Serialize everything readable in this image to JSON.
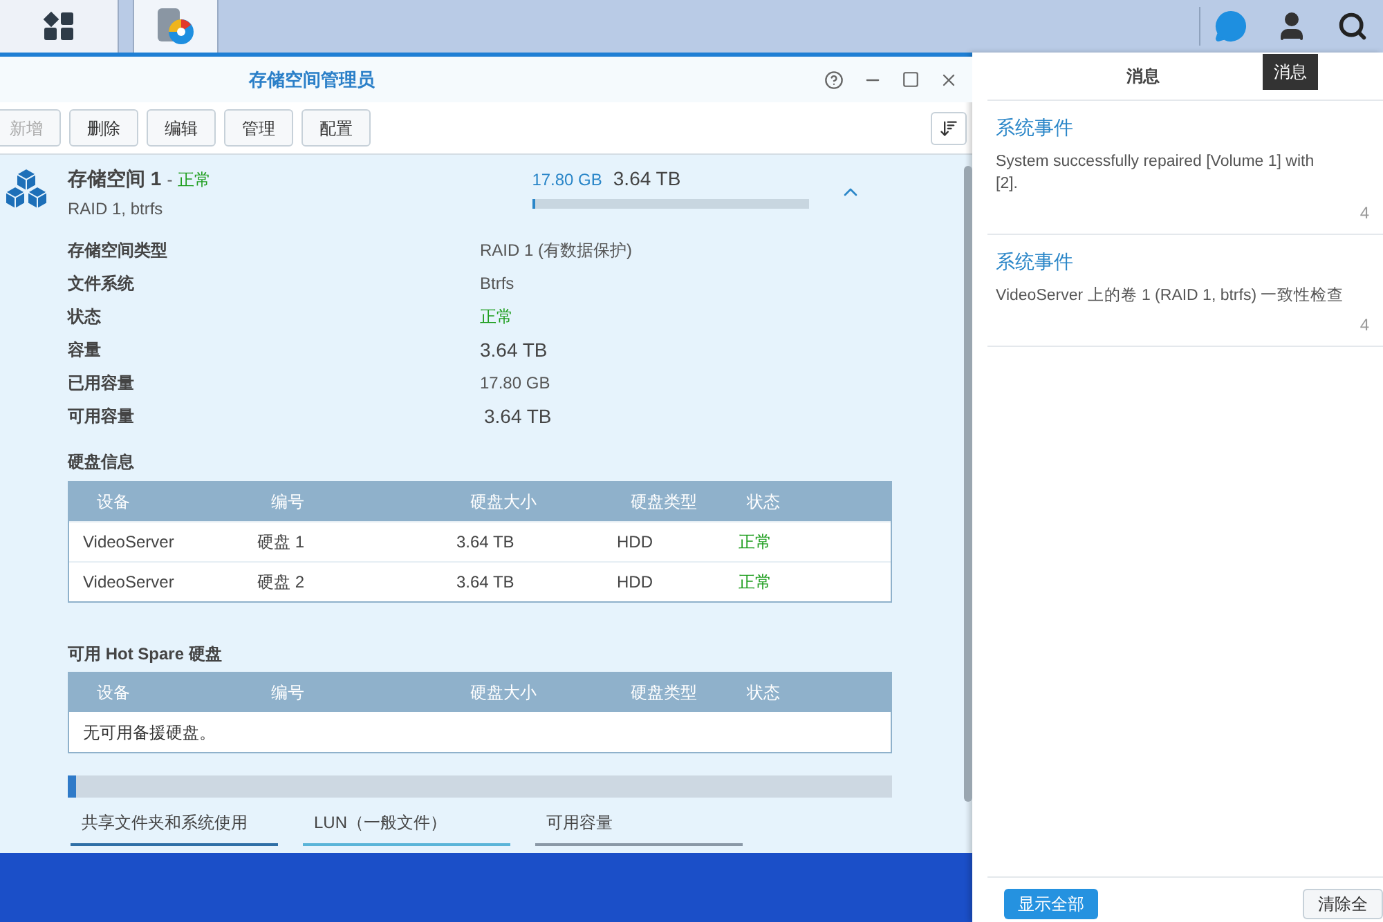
{
  "taskbar": {
    "tooltip": "消息"
  },
  "window": {
    "title": "存储空间管理员"
  },
  "toolbar": [
    {
      "label": "新增",
      "disabled": true
    },
    {
      "label": "删除",
      "disabled": false
    },
    {
      "label": "编辑",
      "disabled": false
    },
    {
      "label": "管理",
      "disabled": false
    },
    {
      "label": "配置",
      "disabled": false
    }
  ],
  "volume": {
    "name": "存储空间 1",
    "separator": "-",
    "status": "正常",
    "subtitle": "RAID 1, btrfs",
    "used": "17.80 GB",
    "total": "3.64 TB",
    "level": 0.01,
    "expanded": true,
    "details": [
      {
        "label": "存储空间类型",
        "value": "RAID 1 (有数据保护)",
        "kind": "plain"
      },
      {
        "label": "文件系统",
        "value": "Btrfs",
        "kind": "plain"
      },
      {
        "label": "状态",
        "value": "正常",
        "kind": "ok"
      },
      {
        "label": "容量",
        "value": "3.64  TB",
        "kind": "large"
      },
      {
        "label": "已用容量",
        "value": "17.80 GB",
        "kind": "plain"
      },
      {
        "label": "可用容量",
        "value": "3.64  TB",
        "kind": "large"
      }
    ]
  },
  "disk_info": {
    "title": "硬盘信息",
    "columns": [
      "设备",
      "编号",
      "硬盘大小",
      "硬盘类型",
      "状态"
    ],
    "rows": [
      [
        "VideoServer",
        "硬盘 1",
        "3.64 TB",
        "HDD",
        "正常"
      ],
      [
        "VideoServer",
        "硬盘 2",
        "3.64 TB",
        "HDD",
        "正常"
      ]
    ]
  },
  "hot_spare": {
    "title": "可用 Hot Spare 硬盘",
    "columns": [
      "设备",
      "编号",
      "硬盘大小",
      "硬盘类型",
      "状态"
    ],
    "empty": "无可用备援硬盘。"
  },
  "usage": {
    "level": 0.01,
    "legend": [
      {
        "label": "共享文件夹和系统使用",
        "color": "#2f6fa6"
      },
      {
        "label": "LUN（一般文件）",
        "color": "#5ab4d8"
      },
      {
        "label": "可用容量",
        "color": "#8a98a6"
      }
    ]
  },
  "notifications": {
    "title": "消息",
    "items": [
      {
        "title": "系统事件",
        "lines": [
          "System successfully repaired [Volume 1] with",
          "[2]."
        ],
        "time": "4"
      },
      {
        "title": "系统事件",
        "lines": [
          "VideoServer 上的卷 1 (RAID 1, btrfs) 一致性检查"
        ],
        "time": "4"
      }
    ],
    "buttons": [
      "显示全部",
      "清除全"
    ]
  }
}
